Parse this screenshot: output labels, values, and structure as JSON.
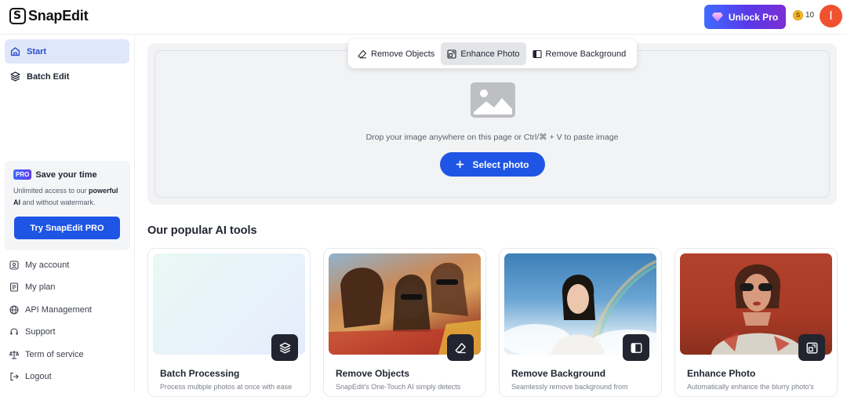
{
  "app": {
    "name": "SnapEdit"
  },
  "header": {
    "unlock_label": "Unlock Pro",
    "credits": "10",
    "avatar_initial": "I"
  },
  "sidebar": {
    "nav": [
      {
        "label": "Start",
        "icon": "home-icon",
        "active": true
      },
      {
        "label": "Batch Edit",
        "icon": "layers-icon",
        "active": false
      }
    ],
    "pro_card": {
      "badge": "PRO",
      "title": "Save your time",
      "desc_prefix": "Unlimited access to our ",
      "desc_bold1": "powerful AI",
      "desc_suffix": " and without watermark.",
      "button": "Try SnapEdit PRO"
    },
    "links": [
      {
        "label": "My account",
        "icon": "user-icon"
      },
      {
        "label": "My plan",
        "icon": "list-icon"
      },
      {
        "label": "API Management",
        "icon": "globe-icon"
      },
      {
        "label": "Support",
        "icon": "headset-icon"
      },
      {
        "label": "Term of service",
        "icon": "scale-icon"
      },
      {
        "label": "Logout",
        "icon": "logout-icon"
      }
    ]
  },
  "editor": {
    "tabs": [
      {
        "label": "Remove Objects",
        "icon": "eraser-icon",
        "active": false
      },
      {
        "label": "Enhance Photo",
        "icon": "enhance-icon",
        "active": true
      },
      {
        "label": "Remove Background",
        "icon": "background-icon",
        "active": false
      }
    ],
    "drop_text": "Drop your image anywhere on this page or Ctrl/⌘ + V to paste image",
    "select_button": "Select photo"
  },
  "tools": {
    "title": "Our popular AI tools",
    "cards": [
      {
        "title": "Batch Processing",
        "desc": "Process multiple photos at once with ease",
        "icon": "layers-icon"
      },
      {
        "title": "Remove Objects",
        "desc": "SnapEdit's One-Touch AI simply detects",
        "icon": "eraser-icon"
      },
      {
        "title": "Remove Background",
        "desc": "Seamlessly remove background from",
        "icon": "background-icon"
      },
      {
        "title": "Enhance Photo",
        "desc": "Automatically enhance the blurry photo's",
        "icon": "enhance-icon"
      }
    ]
  },
  "colors": {
    "accent": "#1f55e5",
    "active_nav_bg": "#dfe7fb",
    "avatar": "#f0522f"
  }
}
